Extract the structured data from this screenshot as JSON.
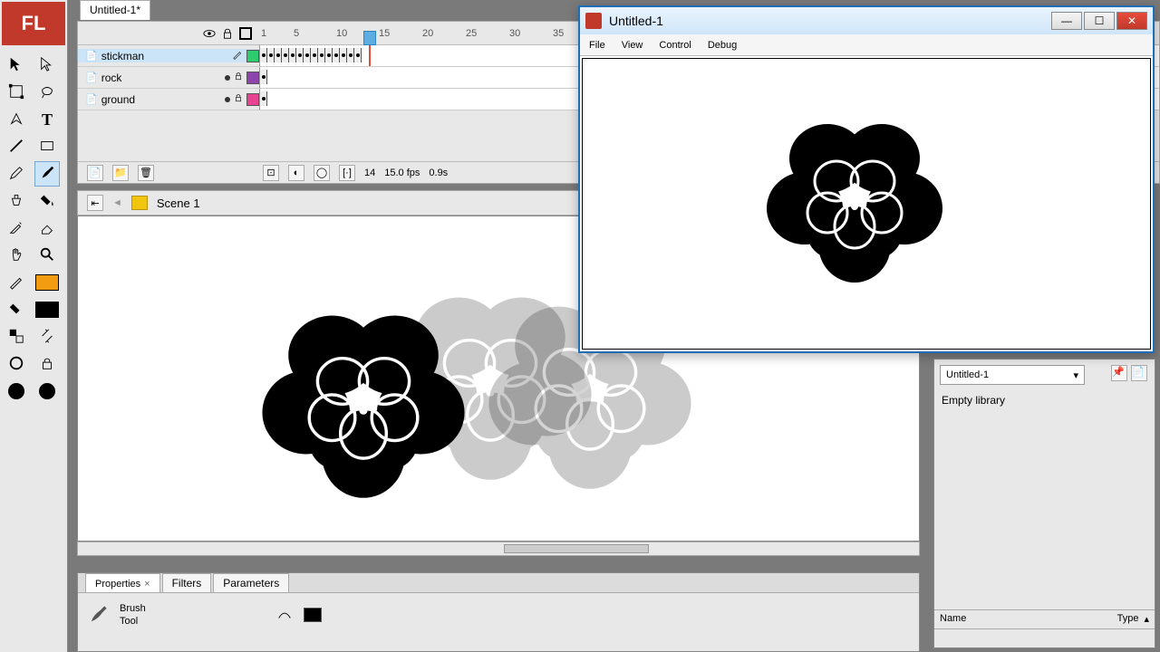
{
  "doc_tab": "Untitled-1*",
  "layers": [
    {
      "name": "stickman",
      "selected": true,
      "colorClass": "lc-green",
      "locked": false
    },
    {
      "name": "rock",
      "selected": false,
      "colorClass": "lc-purple",
      "locked": true
    },
    {
      "name": "ground",
      "selected": false,
      "colorClass": "lc-magenta",
      "locked": true
    }
  ],
  "ruler_marks": [
    "1",
    "5",
    "10",
    "15",
    "20",
    "25",
    "30",
    "35"
  ],
  "timeline_footer": {
    "current_frame": "14",
    "fps": "15.0 fps",
    "time": "0.9s"
  },
  "scene": "Scene 1",
  "properties": {
    "tabs": {
      "properties": "Properties",
      "filters": "Filters",
      "parameters": "Parameters"
    },
    "tool_name_1": "Brush",
    "tool_name_2": "Tool"
  },
  "library": {
    "doc": "Untitled-1",
    "status": "Empty library",
    "col_name": "Name",
    "col_type": "Type"
  },
  "preview": {
    "title": "Untitled-1",
    "menu": {
      "file": "File",
      "view": "View",
      "control": "Control",
      "debug": "Debug"
    }
  }
}
